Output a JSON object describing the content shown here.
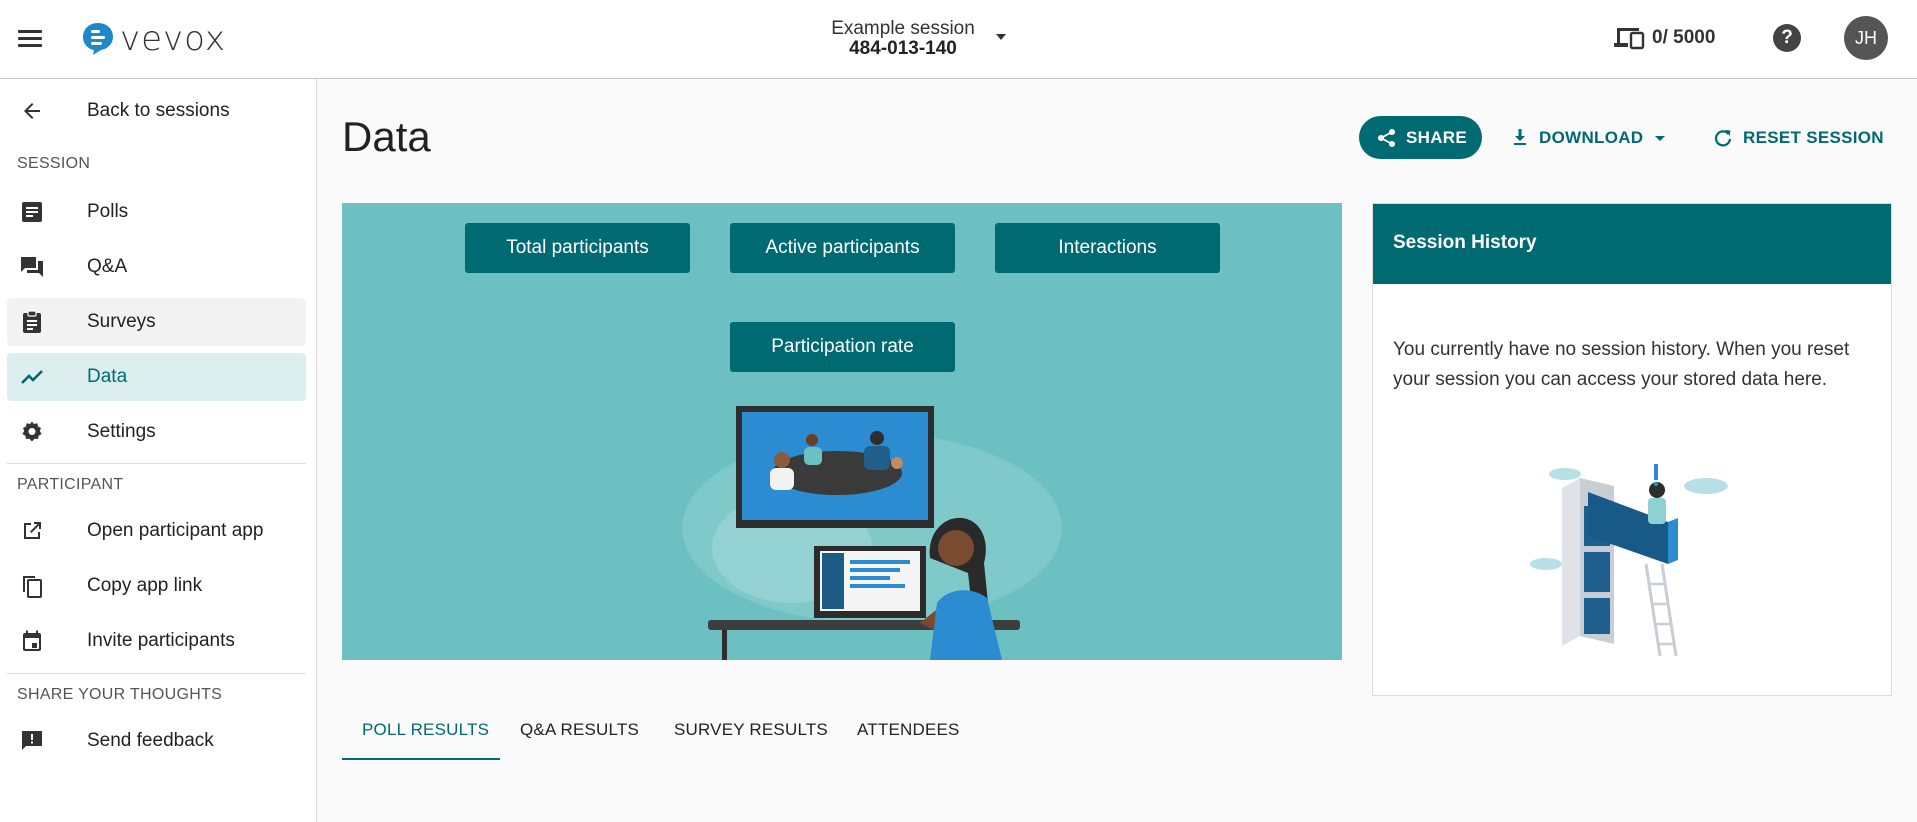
{
  "app": {
    "logo_text": "vevox",
    "session_name": "Example session",
    "session_code": "484-013-140",
    "participant_count": "0/ 5000",
    "help_label": "?",
    "avatar_initials": "JH"
  },
  "sidebar": {
    "back_label": "Back to sessions",
    "section_session": "SESSION",
    "items_session": [
      {
        "label": "Polls",
        "icon": "poll-icon"
      },
      {
        "label": "Q&A",
        "icon": "qa-icon"
      },
      {
        "label": "Surveys",
        "icon": "survey-icon"
      },
      {
        "label": "Data",
        "icon": "chart-line-icon"
      },
      {
        "label": "Settings",
        "icon": "gear-icon"
      }
    ],
    "section_participant": "PARTICIPANT",
    "items_participant": [
      {
        "label": "Open participant app",
        "icon": "open-external-icon"
      },
      {
        "label": "Copy app link",
        "icon": "copy-icon"
      },
      {
        "label": "Invite participants",
        "icon": "calendar-icon"
      }
    ],
    "section_feedback": "SHARE YOUR THOUGHTS",
    "feedback_label": "Send feedback"
  },
  "main": {
    "title": "Data",
    "share_label": "SHARE",
    "download_label": "DOWNLOAD",
    "reset_label": "RESET SESSION",
    "metrics": [
      "Total participants",
      "Active participants",
      "Interactions",
      "Participation rate"
    ],
    "history": {
      "title": "Session History",
      "text": "You currently have no session history. When you reset your session you can access your stored data here."
    },
    "tabs": [
      "POLL RESULTS",
      "Q&A RESULTS",
      "SURVEY RESULTS",
      "ATTENDEES"
    ]
  },
  "colors": {
    "brand": "#006a73",
    "panel": "#6cc0c2",
    "active_bg": "#dcefee"
  }
}
